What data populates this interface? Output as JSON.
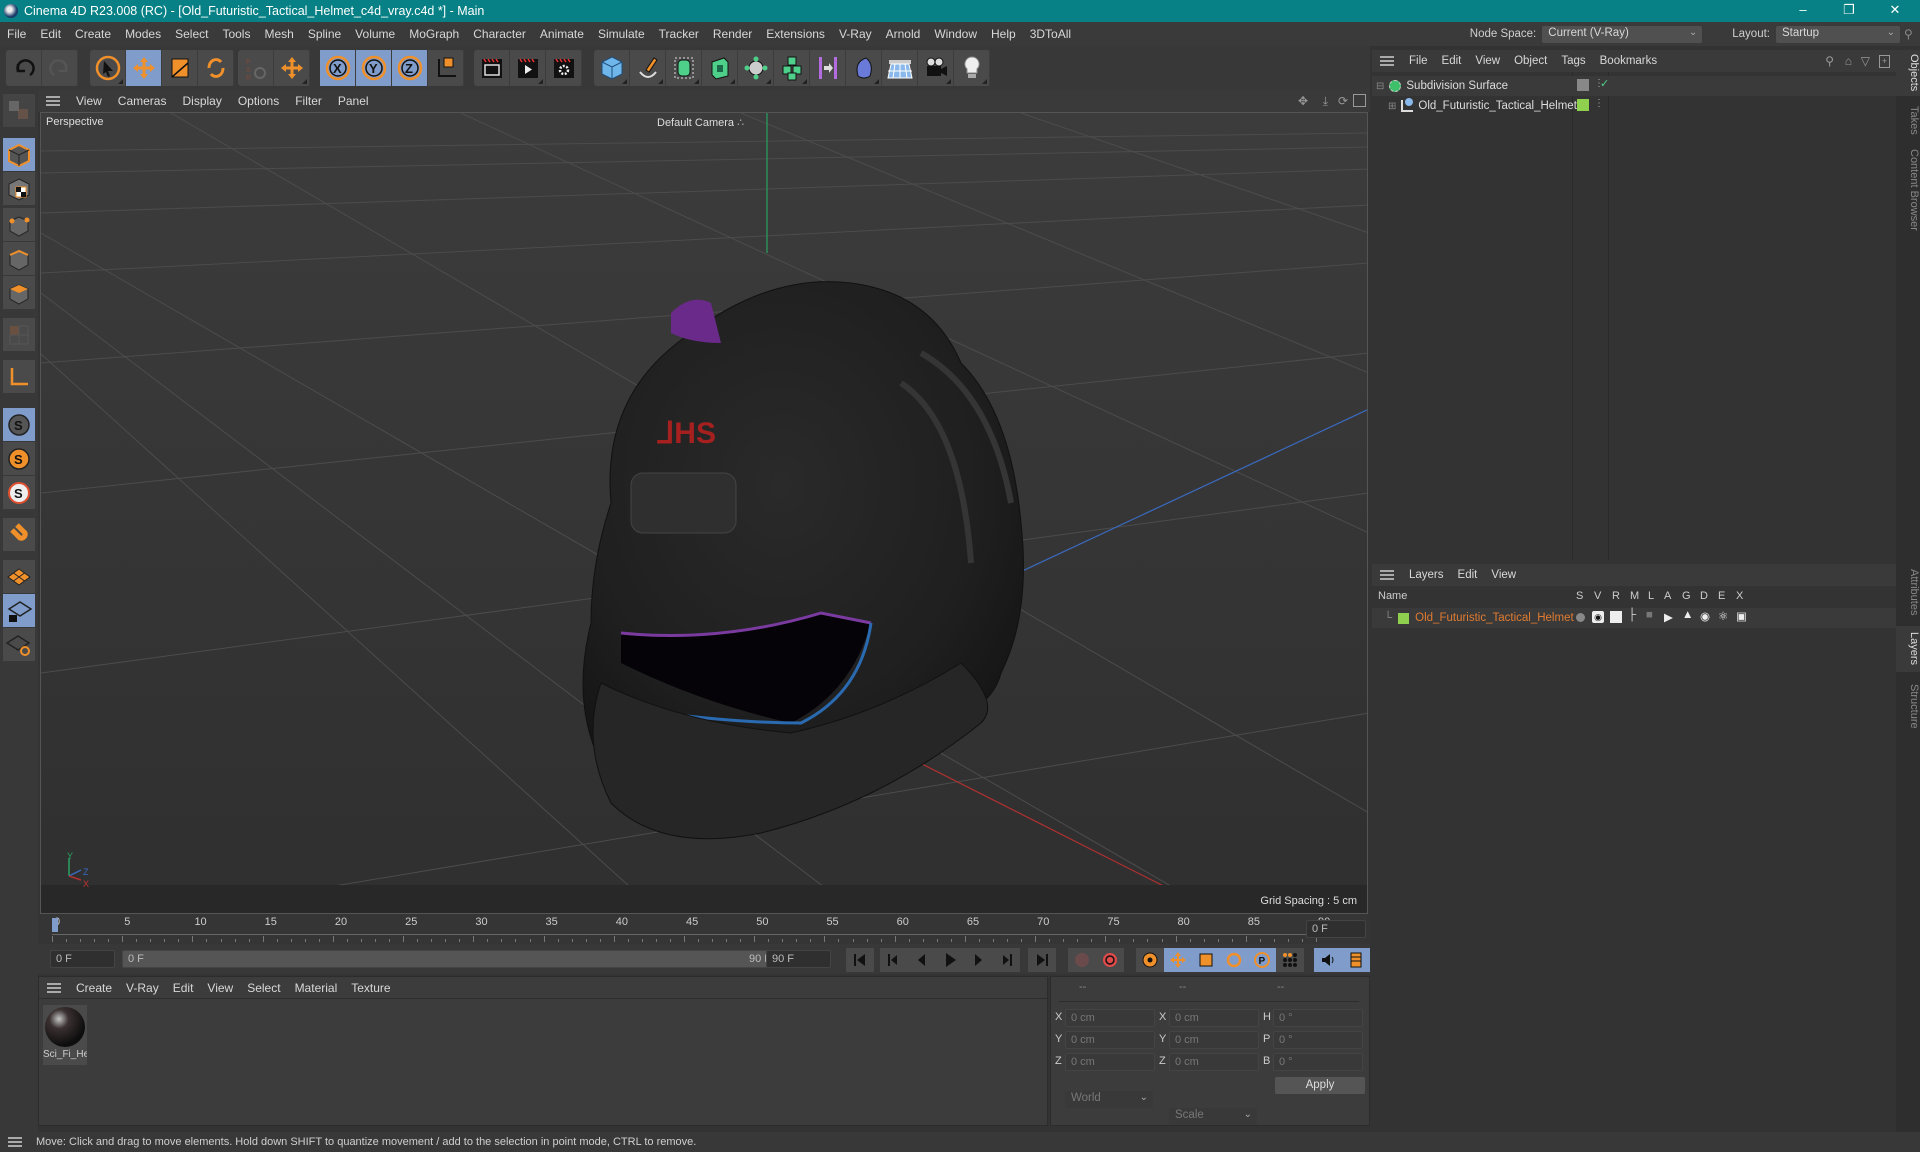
{
  "window": {
    "title": "Cinema 4D R23.008 (RC) - [Old_Futuristic_Tactical_Helmet_c4d_vray.c4d *] - Main",
    "controls": [
      "minimize",
      "restore",
      "close"
    ]
  },
  "menubar": {
    "items": [
      "File",
      "Edit",
      "Create",
      "Modes",
      "Select",
      "Tools",
      "Mesh",
      "Spline",
      "Volume",
      "MoGraph",
      "Character",
      "Animate",
      "Simulate",
      "Tracker",
      "Render",
      "Extensions",
      "V-Ray",
      "Arnold",
      "Window",
      "Help",
      "3DToAll"
    ],
    "node_space_label": "Node Space:",
    "node_space_value": "Current (V-Ray)",
    "layout_label": "Layout:",
    "layout_value": "Startup"
  },
  "toolbar": {
    "groups": [
      [
        "undo-icon",
        "redo-icon"
      ],
      [
        "select-pointer-icon",
        "move-icon",
        "scale-icon",
        "rotate-icon"
      ],
      [
        "psr-icon",
        "add-icon"
      ],
      [
        "x-axis-icon",
        "y-axis-icon",
        "z-axis-icon",
        "coordinate-system-icon"
      ],
      [
        "render-view-icon",
        "render-picture-viewer-icon",
        "render-settings-icon"
      ],
      [
        "cube-icon",
        "pen-icon",
        "subdivision-icon",
        "extrude-icon",
        "cloner-icon",
        "array-icon",
        "symmetry-icon",
        "deformer-icon",
        "floor-icon",
        "camera-icon",
        "light-icon"
      ]
    ]
  },
  "viewport": {
    "menu": [
      "View",
      "Cameras",
      "Display",
      "Options",
      "Filter",
      "Panel"
    ],
    "label": "Perspective",
    "camera": "Default Camera",
    "grid_spacing": "Grid Spacing : 5 cm",
    "axis_labels": {
      "y": "Y",
      "z": "Z",
      "x": "X"
    }
  },
  "left_tools": [
    "make-editable",
    "model-mode",
    "texture-mode",
    "point-mode",
    "edge-mode",
    "polygon-mode",
    "uv-mode",
    "axis-mode",
    "snap-enable",
    "snap-2",
    "snap-3",
    "magnet",
    "workplane",
    "locked-workplane",
    "workplane-sync"
  ],
  "timeline": {
    "ticks": [
      "0",
      "5",
      "10",
      "15",
      "20",
      "25",
      "30",
      "35",
      "40",
      "45",
      "50",
      "55",
      "60",
      "65",
      "70",
      "75",
      "80",
      "85",
      "90"
    ],
    "current_frame": "0 F",
    "start": "0 F",
    "range_start": "0 F",
    "range_end": "90 F",
    "end": "90 F"
  },
  "material_manager": {
    "menu": [
      "Create",
      "V-Ray",
      "Edit",
      "View",
      "Select",
      "Material",
      "Texture"
    ],
    "materials": [
      {
        "name": "Sci_Fi_He"
      }
    ]
  },
  "coordinates": {
    "headers": [
      "--",
      "--",
      "--"
    ],
    "rows": [
      {
        "l1": "X",
        "v1": "0 cm",
        "l2": "X",
        "v2": "0 cm",
        "l3": "H",
        "v3": "0 °"
      },
      {
        "l1": "Y",
        "v1": "0 cm",
        "l2": "Y",
        "v2": "0 cm",
        "l3": "P",
        "v3": "0 °"
      },
      {
        "l1": "Z",
        "v1": "0 cm",
        "l2": "Z",
        "v2": "0 cm",
        "l3": "B",
        "v3": "0 °"
      }
    ],
    "mode": "World",
    "transform": "Scale",
    "apply": "Apply"
  },
  "objects_panel": {
    "menu": [
      "File",
      "Edit",
      "View",
      "Object",
      "Tags",
      "Bookmarks"
    ],
    "items": [
      {
        "name": "Subdivision Surface"
      },
      {
        "name": "Old_Futuristic_Tactical_Helmet",
        "color": "#8fd14f"
      }
    ]
  },
  "layers_panel": {
    "menu": [
      "Layers",
      "Edit",
      "View"
    ],
    "columns": [
      "Name",
      "S",
      "V",
      "R",
      "M",
      "L",
      "A",
      "G",
      "D",
      "E",
      "X"
    ],
    "layers": [
      {
        "name": "Old_Futuristic_Tactical_Helmet",
        "color": "#8fd14f",
        "text_color": "#e07b30"
      }
    ]
  },
  "right_tabs": {
    "top": [
      "Objects",
      "Takes",
      "Content Browser"
    ],
    "bottom": [
      "Attributes",
      "Layers",
      "Structure"
    ]
  },
  "status": "Move: Click and drag to move elements. Hold down SHIFT to quantize movement / add to the selection in point mode, CTRL to remove.",
  "colors": {
    "accent": "#078185",
    "selected": "#7f9ccb",
    "orange": "#f0902a"
  }
}
